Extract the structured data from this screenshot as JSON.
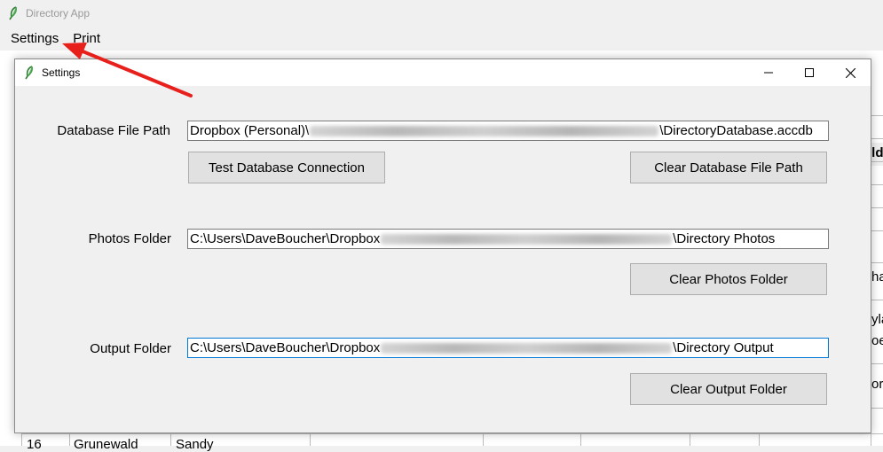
{
  "app": {
    "title": "Directory App",
    "menu": [
      {
        "label": "Settings"
      },
      {
        "label": "Print"
      }
    ]
  },
  "background_table": {
    "fragments": [
      "ild",
      "ha",
      "yla",
      "oe",
      "or",
      "16",
      "Grunewald",
      "Sandy"
    ]
  },
  "dialog": {
    "title": "Settings",
    "window_controls": {
      "minimize": "—",
      "maximize": "☐",
      "close": "✕"
    },
    "database": {
      "label": "Database File Path",
      "value_prefix": "Dropbox (Personal)\\",
      "value_suffix": "\\DirectoryDatabase.accdb",
      "test_button": "Test Database Connection",
      "clear_button": "Clear Database File Path"
    },
    "photos": {
      "label": "Photos Folder",
      "value_prefix": "C:\\Users\\DaveBoucher\\Dropbox",
      "value_suffix": "\\Directory Photos",
      "clear_button": "Clear Photos Folder"
    },
    "output": {
      "label": "Output Folder",
      "value_prefix": "C:\\Users\\DaveBoucher\\Dropbox",
      "value_suffix": "\\Directory Output",
      "clear_button": "Clear Output Folder"
    }
  },
  "colors": {
    "annotation_arrow": "#e8201c",
    "focus_border": "#0078d7",
    "window_bg": "#f0f0f0"
  }
}
